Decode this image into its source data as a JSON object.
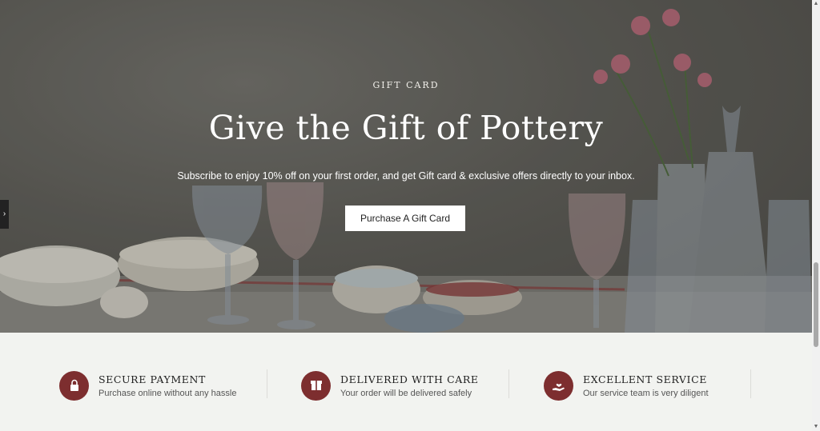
{
  "hero": {
    "eyebrow": "GIFT CARD",
    "title": "Give the Gift of Pottery",
    "subtitle": "Subscribe to enjoy 10% off on your first order, and get Gift card & exclusive offers directly to your inbox.",
    "cta_label": "Purchase A Gift Card",
    "side_tab_icon": "chevron-right-icon"
  },
  "features": [
    {
      "title": "SECURE PAYMENT",
      "description": "Purchase online without any hassle",
      "icon": "lock-icon"
    },
    {
      "title": "DELIVERED WITH CARE",
      "description": "Your order will be delivered safely",
      "icon": "box-icon"
    },
    {
      "title": "EXCELLENT SERVICE",
      "description": "Our service team is very diligent",
      "icon": "hand-heart-icon"
    }
  ],
  "colors": {
    "accent": "#7d2e2f",
    "hero_background": "#5f5e58",
    "features_background": "#f2f3f0"
  }
}
